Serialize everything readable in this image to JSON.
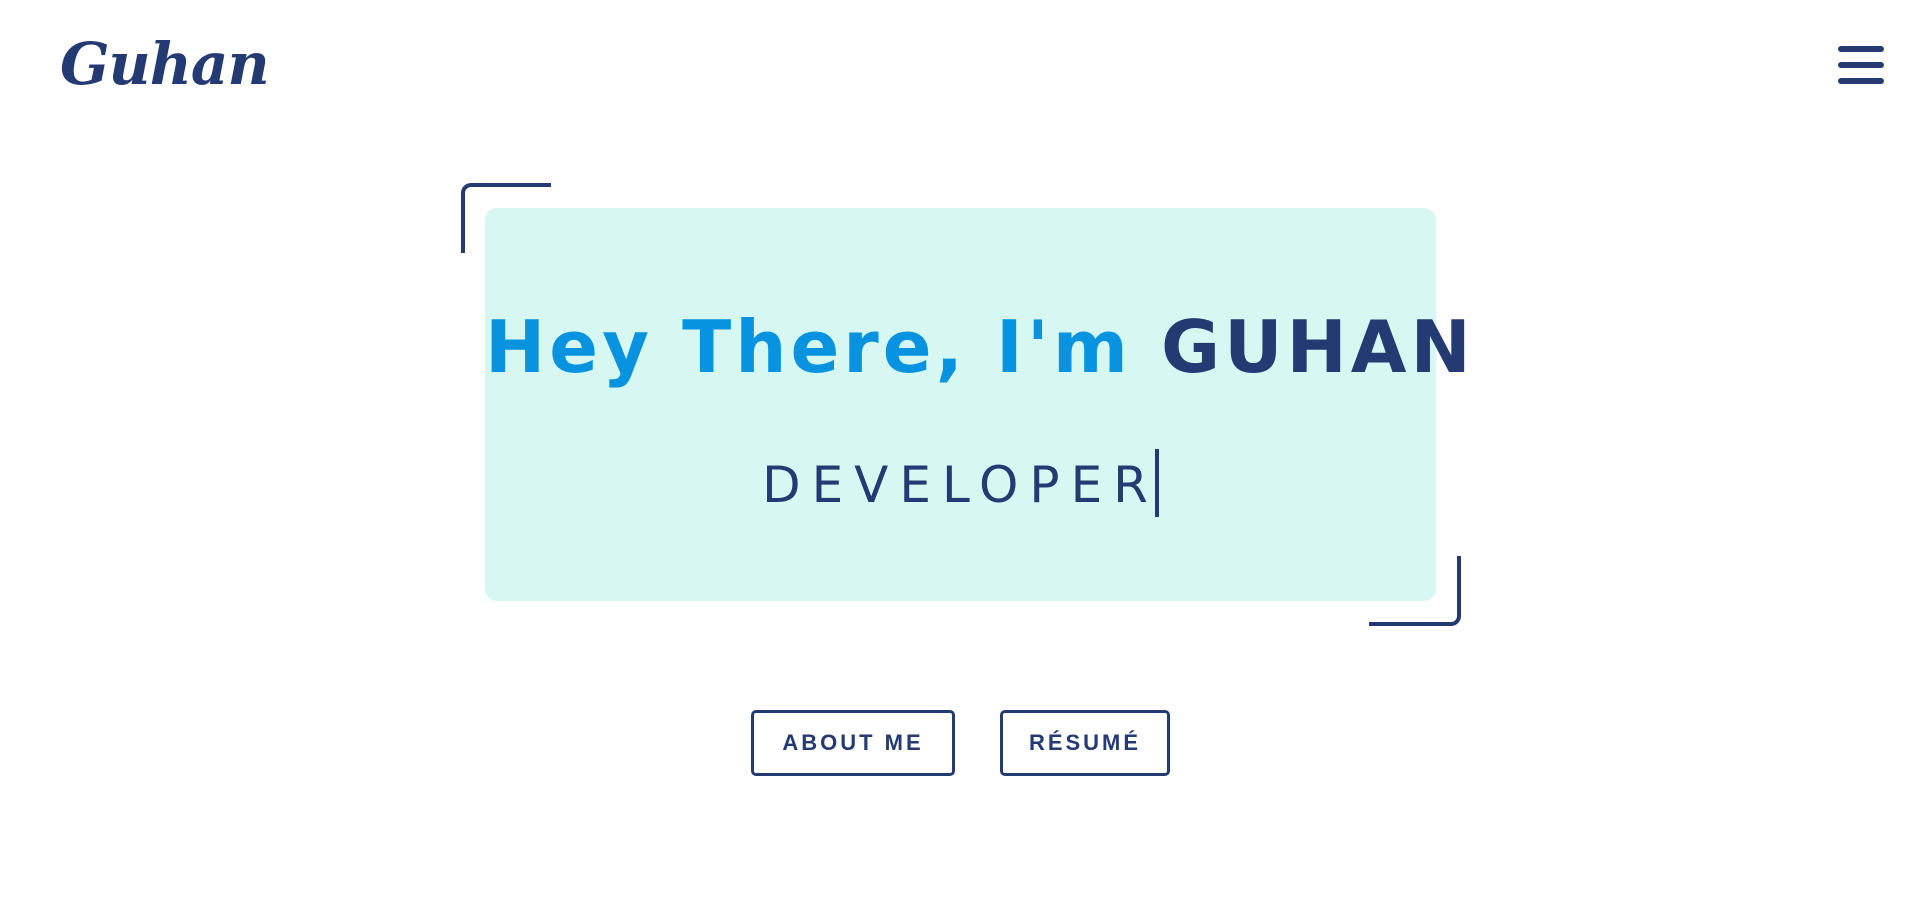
{
  "header": {
    "logo_text": "Guhan",
    "menu_icon": "hamburger-menu-icon"
  },
  "hero": {
    "greeting": "Hey There, I'm ",
    "name": "GUHAN",
    "role": "DEVELOPER"
  },
  "actions": {
    "about_label": "ABOUT ME",
    "resume_label": "RÉSUMÉ"
  },
  "colors": {
    "primary": "#243a73",
    "accent": "#0793e0",
    "card_background": "#d7f8f2",
    "page_background": "#ffffff"
  }
}
